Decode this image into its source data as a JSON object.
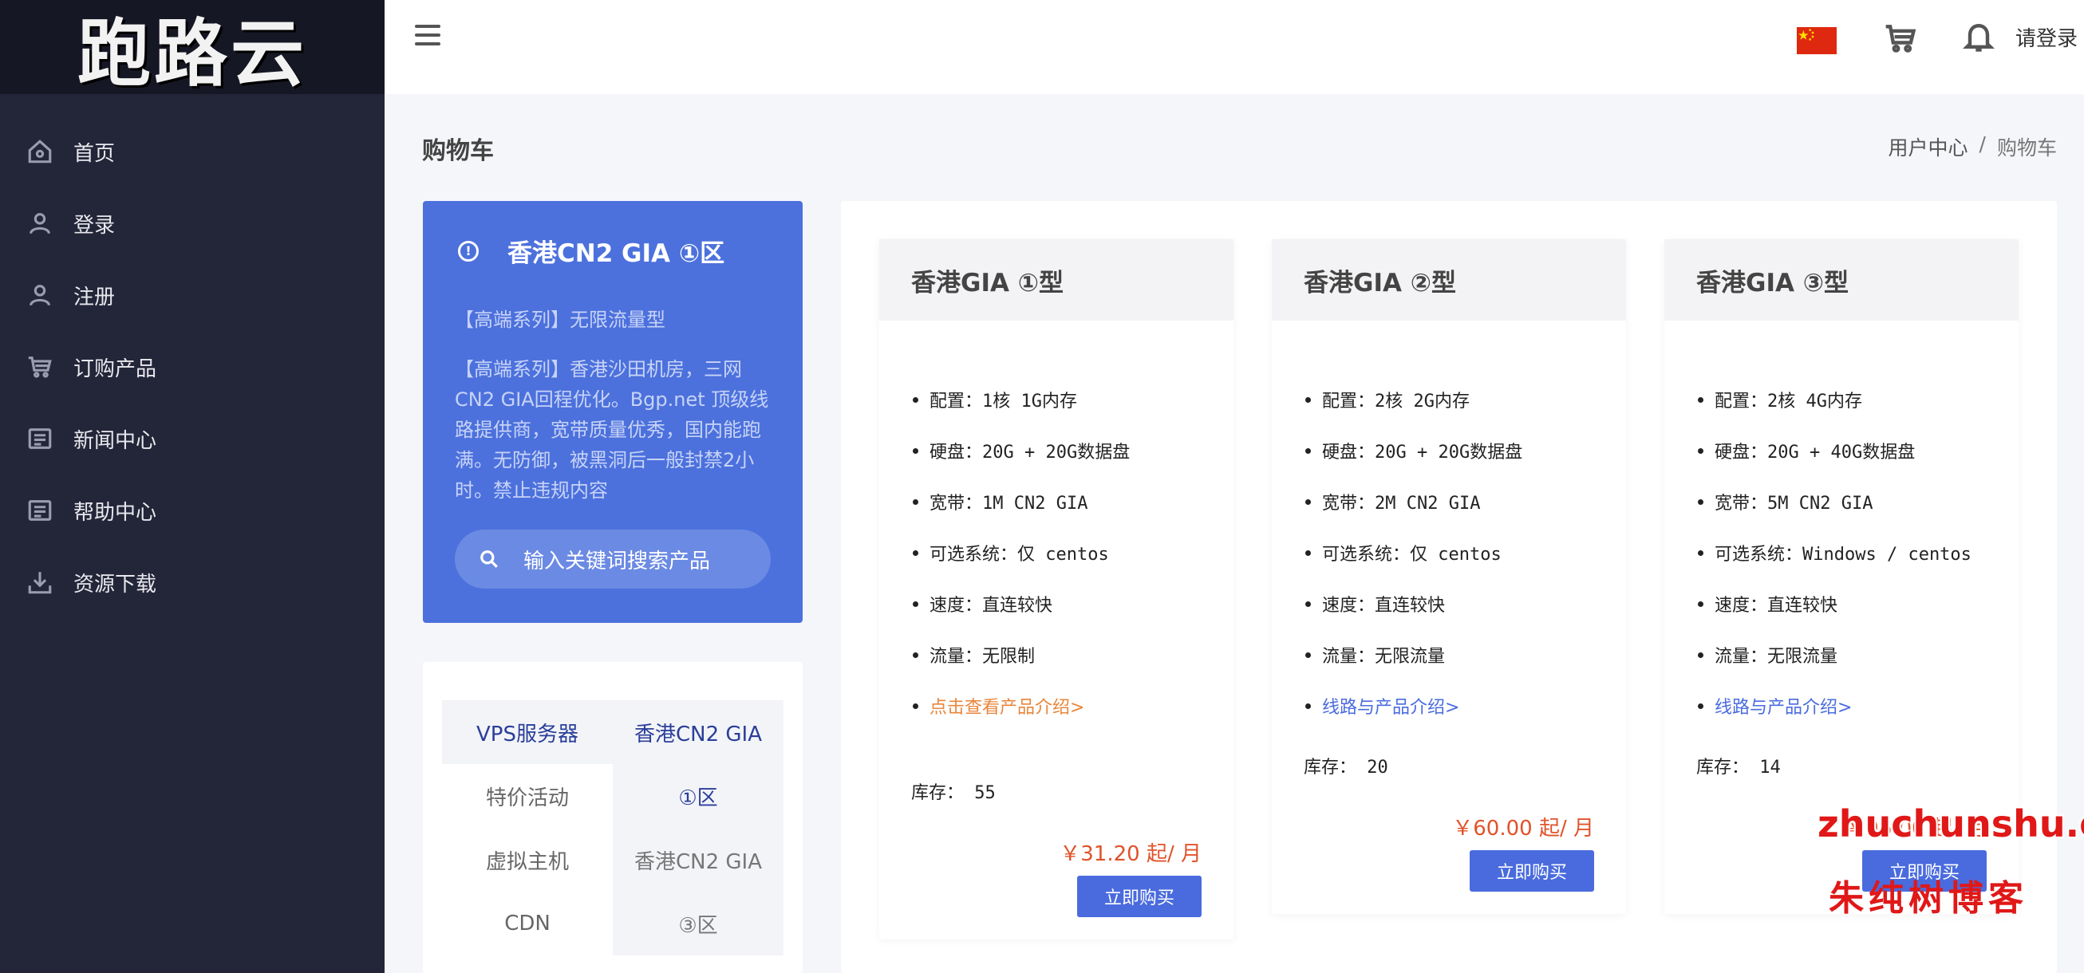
{
  "brand": {
    "logo_text": "跑路云"
  },
  "sidebar": {
    "items": [
      {
        "label": "首页",
        "icon": "home-icon"
      },
      {
        "label": "登录",
        "icon": "user-icon"
      },
      {
        "label": "注册",
        "icon": "user-icon"
      },
      {
        "label": "订购产品",
        "icon": "cart-icon"
      },
      {
        "label": "新闻中心",
        "icon": "document-icon"
      },
      {
        "label": "帮助中心",
        "icon": "document-icon"
      },
      {
        "label": "资源下载",
        "icon": "download-icon"
      }
    ]
  },
  "topbar": {
    "menu_icon": "hamburger-icon",
    "flag": "china-flag",
    "cart_icon": "cart-icon",
    "bell_icon": "bell-icon",
    "login_label": "请登录"
  },
  "page": {
    "title": "购物车",
    "breadcrumb": {
      "home": "用户中心",
      "separator": "/",
      "current": "购物车"
    }
  },
  "promo": {
    "title": "香港CN2 GIA ①区",
    "subtitle": "【高端系列】无限流量型",
    "description": "【高端系列】香港沙田机房，三网CN2 GIA回程优化。Bgp.net 顶级线路提供商，宽带质量优秀，国内能跑满。无防御，被黑洞后一般封禁2小时。禁止违规内容",
    "search_placeholder": "输入关键词搜索产品"
  },
  "categories": {
    "left": [
      "VPS服务器",
      "特价活动",
      "虚拟主机",
      "CDN"
    ],
    "right": [
      "香港CN2 GIA",
      "①区",
      "香港CN2 GIA",
      "③区"
    ]
  },
  "products": [
    {
      "name": "香港GIA ①型",
      "features": [
        "配置：1核 1G内存",
        "硬盘：20G  + 20G数据盘",
        "宽带：1M CN2 GIA",
        "可选系统：仅 centos",
        "速度：直连较快",
        "流量：无限制"
      ],
      "link": "点击查看产品介绍>",
      "stock": "库存： 55",
      "price": "￥31.20 起/ 月",
      "buy_label": "立即购买"
    },
    {
      "name": "香港GIA ②型",
      "features": [
        "配置：2核 2G内存",
        "硬盘：20G  + 20G数据盘",
        "宽带：2M CN2 GIA",
        "可选系统：仅 centos",
        "速度：直连较快",
        "流量：无限流量"
      ],
      "link": "线路与产品介绍>",
      "stock": "库存： 20",
      "price": "￥60.00 起/ 月",
      "buy_label": "立即购买"
    },
    {
      "name": "香港GIA ③型",
      "features": [
        "配置：2核 4G内存",
        "硬盘：20G  + 40G数据盘",
        "宽带：5M CN2 GIA",
        "可选系统：Windows / centos",
        "速度：直连较快",
        "流量：无限流量"
      ],
      "link": "线路与产品介绍>",
      "stock": "库存： 14",
      "price": "￥96.00 起/ 月",
      "buy_label": "立即购买"
    }
  ],
  "watermark": {
    "line1": "zhuchunshu.com",
    "line2": "朱纯树博客"
  },
  "colors": {
    "sidebar": "#232538",
    "accent": "#4c71dd",
    "price": "#e0532b",
    "link_orange": "#e8863b",
    "watermark": "#e01818"
  }
}
